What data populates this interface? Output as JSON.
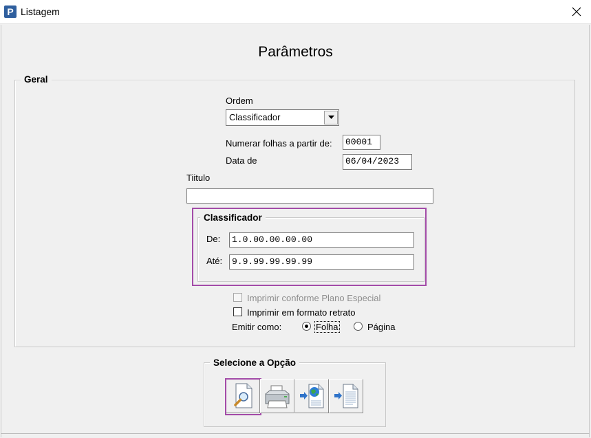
{
  "window": {
    "title": "Listagem",
    "app_icon_letter": "P",
    "close_glyph": "×"
  },
  "page": {
    "title": "Parâmetros"
  },
  "geral": {
    "legend": "Geral",
    "ordem_label": "Ordem",
    "ordem_value": "Classificador",
    "numerar_label": "Numerar folhas a partir de:",
    "numerar_value": "00001",
    "data_label": "Data de",
    "data_value": "06/04/2023",
    "titulo_label": "Tiitulo",
    "titulo_value": ""
  },
  "classificador": {
    "legend": "Classificador",
    "de_label": "De:",
    "de_value": "1.0.00.00.00.00",
    "ate_label": "Até:",
    "ate_value": "9.9.99.99.99.99"
  },
  "options": {
    "plano_especial_label": "Imprimir conforme Plano Especial",
    "plano_especial_checked": false,
    "plano_especial_enabled": false,
    "retrato_label": "Imprimir em formato retrato",
    "retrato_checked": false,
    "emitir_label": "Emitir como:",
    "folha_label": "Folha",
    "pagina_label": "Página",
    "emitir_selected": "Folha"
  },
  "selecione": {
    "legend": "Selecione a Opção",
    "buttons": [
      {
        "name": "preview",
        "icon": "magnifier-document-icon"
      },
      {
        "name": "print",
        "icon": "printer-icon"
      },
      {
        "name": "export-web",
        "icon": "globe-document-icon"
      },
      {
        "name": "export-file",
        "icon": "document-icon"
      }
    ]
  },
  "colors": {
    "highlight": "#a34ba8",
    "background": "#f0f0f0",
    "app_icon": "#2f5f9e"
  }
}
